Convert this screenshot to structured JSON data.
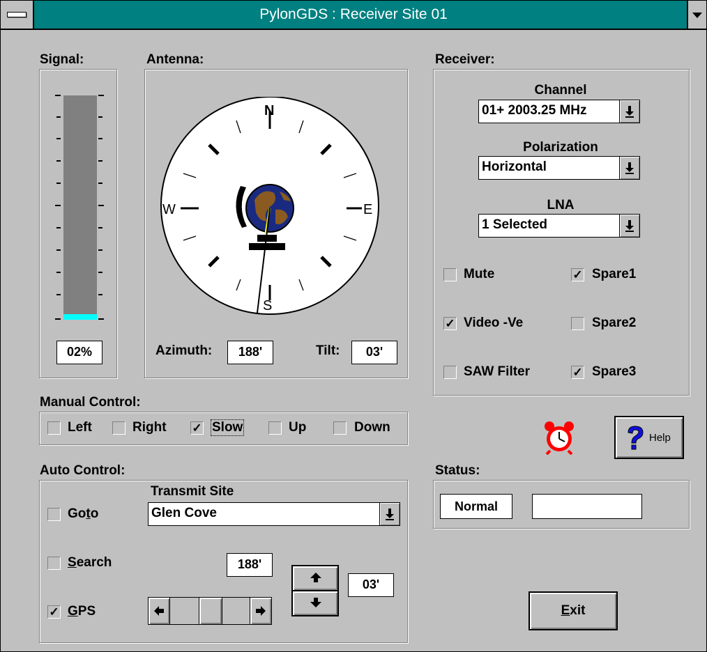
{
  "window": {
    "title": "PylonGDS : Receiver Site 01"
  },
  "signal": {
    "label": "Signal:",
    "level_percent": 2,
    "value": "02%"
  },
  "antenna": {
    "label": "Antenna:",
    "compass": {
      "n": "N",
      "s": "S",
      "e": "E",
      "w": "W"
    },
    "azimuth_label": "Azimuth:",
    "azimuth_value": "188'",
    "tilt_label": "Tilt:",
    "tilt_value": "03'"
  },
  "receiver": {
    "label": "Receiver:",
    "channel_label": "Channel",
    "channel_value": "01+ 2003.25 MHz",
    "polarization_label": "Polarization",
    "polarization_value": "Horizontal",
    "lna_label": "LNA",
    "lna_value": "1 Selected",
    "checks": {
      "mute": {
        "label": "Mute",
        "checked": false
      },
      "spare1": {
        "label": "Spare1",
        "checked": true
      },
      "video": {
        "label": "Video -Ve",
        "checked": true
      },
      "spare2": {
        "label": "Spare2",
        "checked": false
      },
      "saw": {
        "label": "SAW Filter",
        "checked": false
      },
      "spare3": {
        "label": "Spare3",
        "checked": true
      }
    }
  },
  "manual": {
    "label": "Manual Control:",
    "left": {
      "label": "Left",
      "checked": false
    },
    "right": {
      "label": "Right",
      "checked": false
    },
    "slow": {
      "label": "Slow",
      "checked": true
    },
    "up": {
      "label": "Up",
      "checked": false
    },
    "down": {
      "label": "Down",
      "checked": false
    }
  },
  "auto": {
    "label": "Auto Control:",
    "transmit_site_label": "Transmit Site",
    "transmit_site_value": "Glen Cove",
    "goto": {
      "label_pre": "Go",
      "label_key": "t",
      "label_post": "o",
      "checked": false
    },
    "search": {
      "label_pre": "",
      "label_key": "S",
      "label_post": "earch",
      "checked": false
    },
    "gps": {
      "label_pre": "",
      "label_key": "G",
      "label_post": "PS",
      "checked": true
    },
    "azimuth_value": "188'",
    "tilt_value": "03'"
  },
  "help": {
    "label": "Help"
  },
  "status": {
    "label": "Status:",
    "value": "Normal",
    "value2": ""
  },
  "exit": {
    "label_key": "E",
    "label_post": "xit"
  },
  "check_glyph": "✓",
  "icons": {
    "alarm": "alarm-clock-icon",
    "help": "question-mark-icon"
  },
  "colors": {
    "title_bar": "#008080",
    "signal_level": "#00ffff",
    "window": "#c0c0c0"
  }
}
